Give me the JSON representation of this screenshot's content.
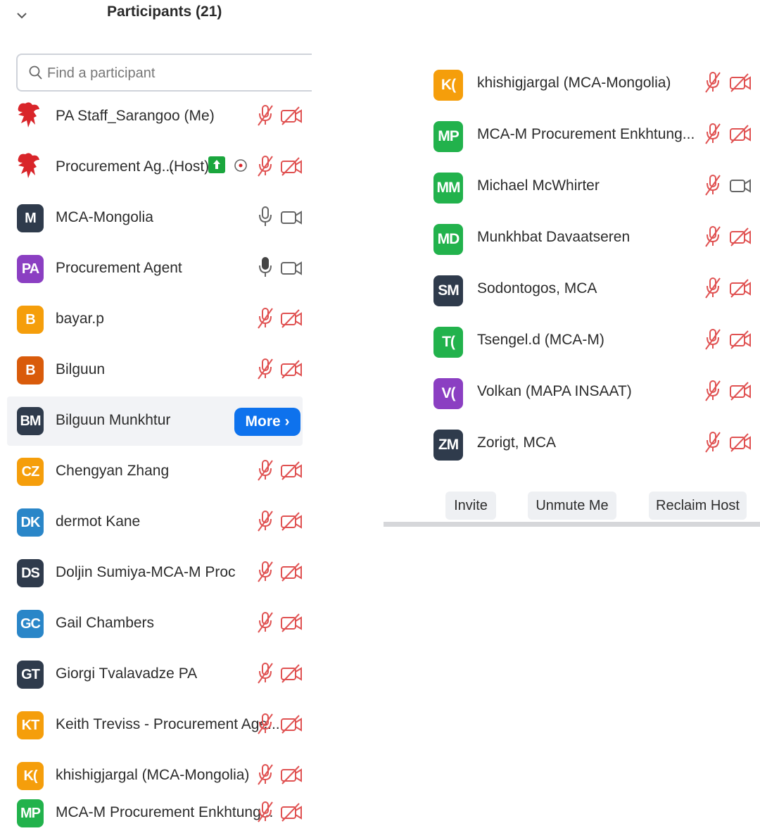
{
  "colors": {
    "accent_blue": "#0e72ed",
    "muted_red": "#d9534f",
    "share_green": "#1aa63d",
    "orange": "#f59e0b",
    "dark_orange": "#d95b0b",
    "green": "#22b24c",
    "navy": "#2f3b4c",
    "purple": "#8b3fc2",
    "blue": "#2a86c8"
  },
  "header": {
    "collapse_icon": "chevron-down-icon",
    "title": "Participants (21)"
  },
  "search": {
    "placeholder": "Find a participant",
    "icon": "search-icon"
  },
  "participants": [
    {
      "initials": "",
      "logo": "red-dragon-logo",
      "name": "PA Staff_Sarangoo (Me)",
      "mic": "muted",
      "video": "off"
    },
    {
      "initials": "",
      "logo": "red-dragon-logo",
      "name": "Procurement Ag...",
      "role": "(Host)",
      "sharing": true,
      "mic": "muted",
      "video": "off"
    },
    {
      "initials": "M",
      "color": "#2f3b4c",
      "name": "MCA-Mongolia",
      "mic": "on",
      "video": "on"
    },
    {
      "initials": "PA",
      "color": "#8b3fc2",
      "name": "Procurement Agent",
      "mic": "speaking",
      "video": "on"
    },
    {
      "initials": "B",
      "color": "#f59e0b",
      "name": "bayar.p",
      "mic": "muted",
      "video": "off"
    },
    {
      "initials": "B",
      "color": "#d95b0b",
      "name": "Bilguun",
      "mic": "muted",
      "video": "off"
    },
    {
      "initials": "BM",
      "color": "#2f3b4c",
      "name": "Bilguun Munkhtur",
      "more_button": "More ›",
      "highlighted": true
    },
    {
      "initials": "CZ",
      "color": "#f59e0b",
      "name": "Chengyan Zhang",
      "mic": "muted",
      "video": "off"
    },
    {
      "initials": "DK",
      "color": "#2a86c8",
      "name": "dermot Kane",
      "mic": "muted",
      "video": "off"
    },
    {
      "initials": "DS",
      "color": "#2f3b4c",
      "name": "Doljin Sumiya-MCA-M Proc",
      "mic": "muted",
      "video": "off"
    },
    {
      "initials": "GC",
      "color": "#2a86c8",
      "name": "Gail Chambers",
      "mic": "muted",
      "video": "off"
    },
    {
      "initials": "GT",
      "color": "#2f3b4c",
      "name": "Giorgi Tvalavadze PA",
      "mic": "muted",
      "video": "off"
    },
    {
      "initials": "KT",
      "color": "#f59e0b",
      "name": "Keith Treviss - Procurement Age...",
      "mic": "muted",
      "video": "off"
    },
    {
      "initials": "K(",
      "color": "#f59e0b",
      "name": "khishigjargal (MCA-Mongolia)",
      "mic": "muted",
      "video": "off"
    },
    {
      "initials": "MP",
      "color": "#22b24c",
      "name": "MCA-M Procurement Enkhtung...",
      "mic": "muted",
      "video": "off"
    }
  ],
  "participants_continued": [
    {
      "initials": "K(",
      "color": "#f59e0b",
      "name": "khishigjargal (MCA-Mongolia)",
      "mic": "muted",
      "video": "off"
    },
    {
      "initials": "MP",
      "color": "#22b24c",
      "name": "MCA-M Procurement Enkhtung...",
      "mic": "muted",
      "video": "off"
    },
    {
      "initials": "MM",
      "color": "#22b24c",
      "name": "Michael McWhirter",
      "mic": "muted",
      "video": "on"
    },
    {
      "initials": "MD",
      "color": "#22b24c",
      "name": "Munkhbat Davaatseren",
      "mic": "muted",
      "video": "off"
    },
    {
      "initials": "SM",
      "color": "#2f3b4c",
      "name": "Sodontogos, MCA",
      "mic": "muted",
      "video": "off"
    },
    {
      "initials": "T(",
      "color": "#22b24c",
      "name": "Tsengel.d (MCA-M)",
      "mic": "muted",
      "video": "off"
    },
    {
      "initials": "V(",
      "color": "#8b3fc2",
      "name": "Volkan (MAPA INSAAT)",
      "mic": "muted",
      "video": "off"
    },
    {
      "initials": "ZM",
      "color": "#2f3b4c",
      "name": "Zorigt, MCA",
      "mic": "muted",
      "video": "off"
    }
  ],
  "footer": {
    "invite": "Invite",
    "unmute_me": "Unmute Me",
    "reclaim_host": "Reclaim Host"
  }
}
